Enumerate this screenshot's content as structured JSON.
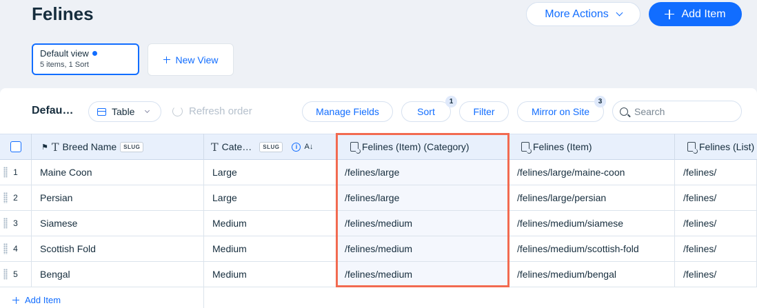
{
  "header": {
    "title": "Felines",
    "more_actions": "More Actions",
    "add_item": "Add Item"
  },
  "views": {
    "active": {
      "name": "Default view",
      "meta": "5 items, 1 Sort"
    },
    "new_view": "New View"
  },
  "toolbar": {
    "title": "Defau…",
    "layout": "Table",
    "refresh": "Refresh order",
    "manage_fields": "Manage Fields",
    "sort": "Sort",
    "sort_count": "1",
    "filter": "Filter",
    "mirror": "Mirror on Site",
    "mirror_count": "3",
    "search_placeholder": "Search"
  },
  "columns": [
    {
      "label": "Breed Name",
      "tag": "SLUG"
    },
    {
      "label": "Cate…",
      "tag": "SLUG"
    },
    {
      "label": "Felines (Item) (Category)"
    },
    {
      "label": "Felines (Item)"
    },
    {
      "label": "Felines (List)"
    }
  ],
  "rows": [
    {
      "n": "1",
      "breed": "Maine Coon",
      "cat": "Large",
      "itemcat": "/felines/large",
      "item": "/felines/large/maine-coon",
      "list": "/felines/"
    },
    {
      "n": "2",
      "breed": "Persian",
      "cat": "Large",
      "itemcat": "/felines/large",
      "item": "/felines/large/persian",
      "list": "/felines/"
    },
    {
      "n": "3",
      "breed": "Siamese",
      "cat": "Medium",
      "itemcat": "/felines/medium",
      "item": "/felines/medium/siamese",
      "list": "/felines/"
    },
    {
      "n": "4",
      "breed": "Scottish Fold",
      "cat": "Medium",
      "itemcat": "/felines/medium",
      "item": "/felines/medium/scottish-fold",
      "list": "/felines/"
    },
    {
      "n": "5",
      "breed": "Bengal",
      "cat": "Medium",
      "itemcat": "/felines/medium",
      "item": "/felines/medium/bengal",
      "list": "/felines/"
    }
  ],
  "footer": {
    "add_item": "Add Item"
  },
  "colors": {
    "accent": "#116dff",
    "highlight": "#f26a50",
    "header_bg": "#e8f0fc"
  }
}
